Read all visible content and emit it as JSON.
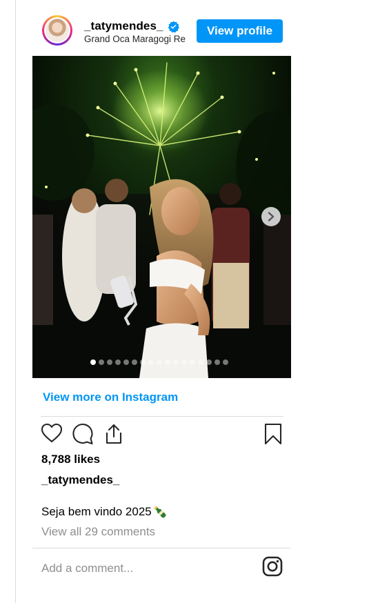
{
  "post": {
    "username": "_tatymendes_",
    "location": "Grand Oca Maragogi Resort",
    "view_profile_label": "View profile",
    "view_more_label": "View more on Instagram",
    "likes": "8,788 likes",
    "caption_user": "_tatymendes_",
    "caption_text": "Seja bem vindo 2025",
    "comments_link": "View all 29 comments",
    "add_comment_placeholder": "Add a comment...",
    "carousel": {
      "slide_count": 17,
      "current_slide": 1
    }
  },
  "colors": {
    "accent": "#0095f6",
    "muted_text": "#8e8e8e",
    "divider": "#dbdbdb"
  },
  "icons": {
    "verified": "verified-badge-icon",
    "next": "chevron-right-icon",
    "like": "heart-icon",
    "comment": "speech-bubble-icon",
    "share": "share-icon",
    "save": "bookmark-icon",
    "brand": "instagram-logo-icon",
    "caption_emoji": "champagne-bottle-icon"
  }
}
